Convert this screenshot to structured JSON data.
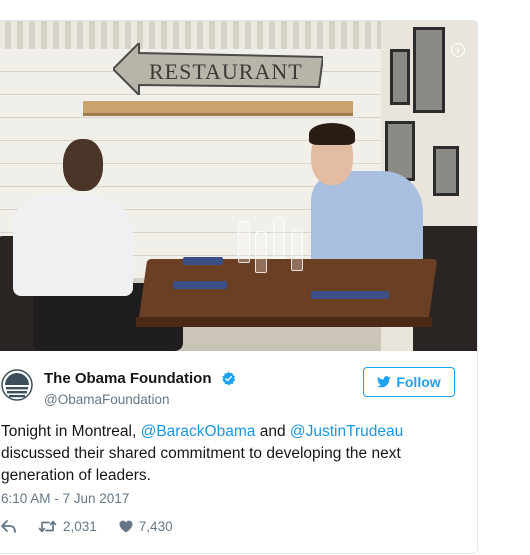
{
  "tweet": {
    "display_name": "The Obama Foundation",
    "handle": "@ObamaFoundation",
    "verified_icon": "verified-badge-icon",
    "follow_label": "Follow",
    "text_segments": [
      {
        "text": "Tonight in Montreal, ",
        "mention": false
      },
      {
        "text": "@BarackObama",
        "mention": true
      },
      {
        "text": " and ",
        "mention": false
      },
      {
        "text": "@JustinTrudeau",
        "mention": true
      },
      {
        "text": " discussed their shared commitment to developing the next generation of leaders.",
        "mention": false
      }
    ],
    "timestamp": "6:10 AM - 7 Jun 2017",
    "retweets": "2,031",
    "likes": "7,430"
  },
  "photo": {
    "sign_text": "RESTAURANT",
    "info_icon": "i"
  },
  "colors": {
    "accent": "#1da1f2",
    "mention": "#1b95e0",
    "secondary_text": "#657786",
    "border": "#e1e8ed"
  }
}
